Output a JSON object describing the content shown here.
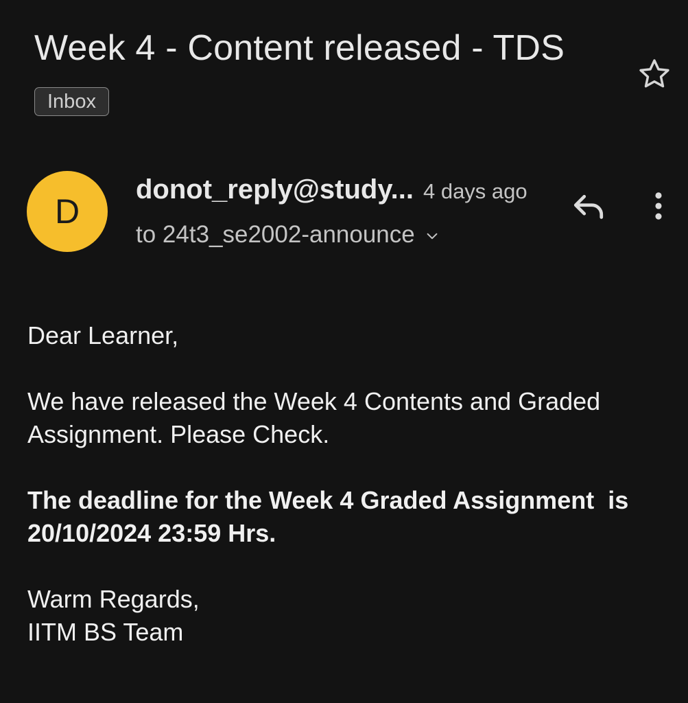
{
  "email": {
    "subject": "Week 4 - Content released - TDS",
    "label": "Inbox",
    "starred": false,
    "star_icon": "star-outline-icon",
    "sender": {
      "avatar_letter": "D",
      "avatar_color": "#f6be2c",
      "name": "donot_reply@study...",
      "time": "4 days ago",
      "recipient": "to 24t3_se2002-announce"
    },
    "actions": {
      "reply_icon": "reply-icon",
      "more_icon": "more-vert-icon",
      "expand_icon": "chevron-down-icon"
    },
    "body": {
      "greeting": "Dear Learner,",
      "paragraph1_line1": "We have released the Week 4 Contents and Graded",
      "paragraph1_line2": "Assignment. Please Check.",
      "deadline_line1": "The deadline for the Week 4 Graded Assignment  is",
      "deadline_line2": "20/10/2024 23:59 Hrs.",
      "signoff": "Warm Regards,",
      "signature": "IITM BS Team"
    }
  },
  "colors": {
    "background": "#131313",
    "text": "#e8e8e8",
    "muted_text": "#c4c4c4",
    "avatar": "#f6be2c"
  }
}
